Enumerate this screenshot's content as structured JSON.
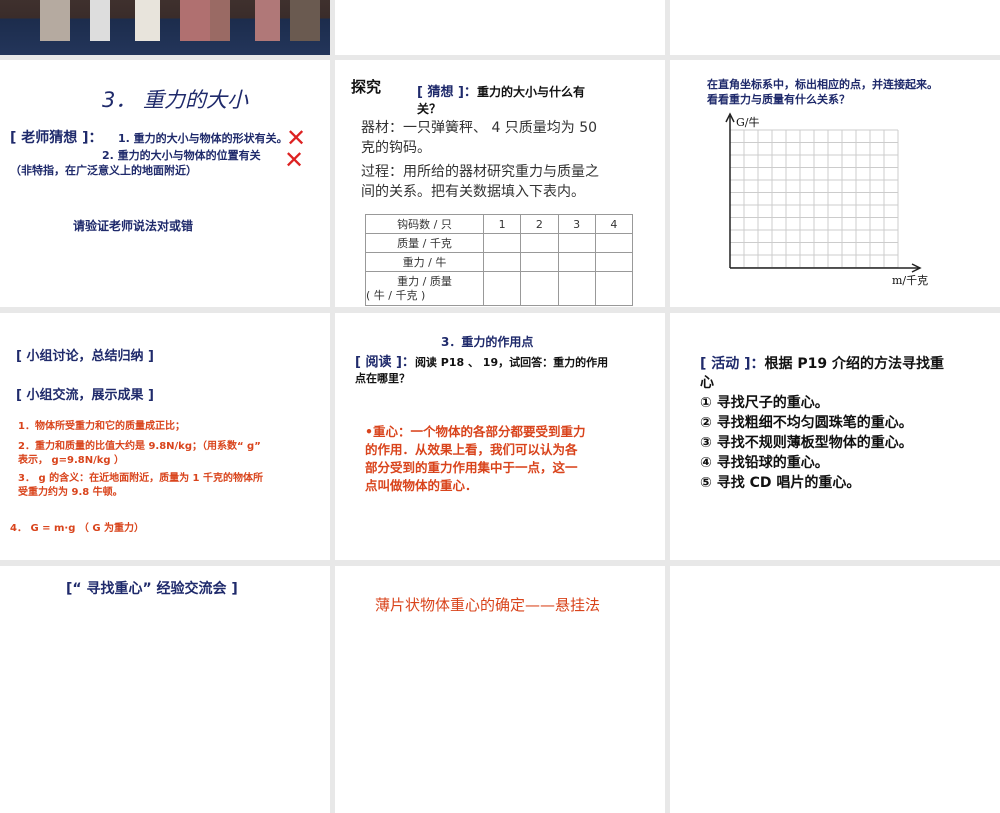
{
  "slide_sorter": {
    "slide_photo": {
      "icon": "city-skyline-photo"
    },
    "slide_gravity_size": {
      "title": "3． 重力的大小",
      "teacher_label": "[ 老师猜想 ]：",
      "guess1": "1. 重力的大小与物体的形状有关。",
      "guess2": "2. 重力的大小与物体的位置有关",
      "note": "（非特指，在广泛意义上的地面附近）",
      "verify": "请验证老师说法对或错"
    },
    "slide_explore": {
      "heading": "探究",
      "guess_label": "[ 猜想 ]：",
      "guess_text": "重力的大小与什么有",
      "guess_text2": "关？",
      "equipment1": "器材：一只弹簧秤、 4 只质量均为 50",
      "equipment2": "克的钩码。",
      "process1": "过程：用所给的器材研究重力与质量之",
      "process2": "间的关系。把有关数据填入下表内。",
      "table": {
        "headers": [
          "钩码数 / 只",
          "1",
          "2",
          "3",
          "4"
        ],
        "rows": [
          "质量 / 千克",
          "重力 / 牛",
          "重力 / 质量",
          "( 牛 / 千克 )"
        ]
      }
    },
    "slide_graph": {
      "line1": "在直角坐标系中，标出相应的点，并连接起来。",
      "line2": "看看重力与质量有什么关系？",
      "y_label": "G/牛",
      "x_label": "m/千克"
    },
    "slide_summary": {
      "h1": "[ 小组讨论，总结归纳 ]",
      "h2": "[ 小组交流，展示成果 ]",
      "p1": "1．物体所受重力和它的质量成正比；",
      "p2a": "2．重力和质量的比值大约是 9.8N/kg；（用系数“ g”",
      "p2b": "表示， g=9.8N/kg ）",
      "p3a": "3． g 的含义：在近地面附近，质量为 1 千克的物体所",
      "p3b": "受重力约为 9.8 牛顿。",
      "p4": "4． G = m·g （ G 为重力）"
    },
    "slide_point": {
      "title": "3．重力的作用点",
      "read_label": "[ 阅读 ]：",
      "read_text": "阅读 P18 、 19，试回答：重力的作用",
      "read_text2": "点在哪里？",
      "def1": "•重心：一个物体的各部分都要受到重力",
      "def2": "的作用．从效果上看，我们可以认为各",
      "def3": "部分受到的重力作用集中于一点，这一",
      "def4": "点叫做物体的重心．"
    },
    "slide_activity": {
      "label": "[ 活动 ]：",
      "text": "根据 P19 介绍的方法寻找重",
      "text2": "心",
      "items": [
        "① 寻找尺子的重心。",
        "② 寻找粗细不均匀圆珠笔的重心。",
        "③ 寻找不规则薄板型物体的重心。",
        "④ 寻找铅球的重心。",
        "⑤ 寻找 CD 唱片的重心。"
      ]
    },
    "slide_exchange": {
      "title": "[“ 寻找重心” 经验交流会 ]"
    },
    "slide_hang": {
      "title": "薄片状物体重心的确定——悬挂法"
    }
  }
}
